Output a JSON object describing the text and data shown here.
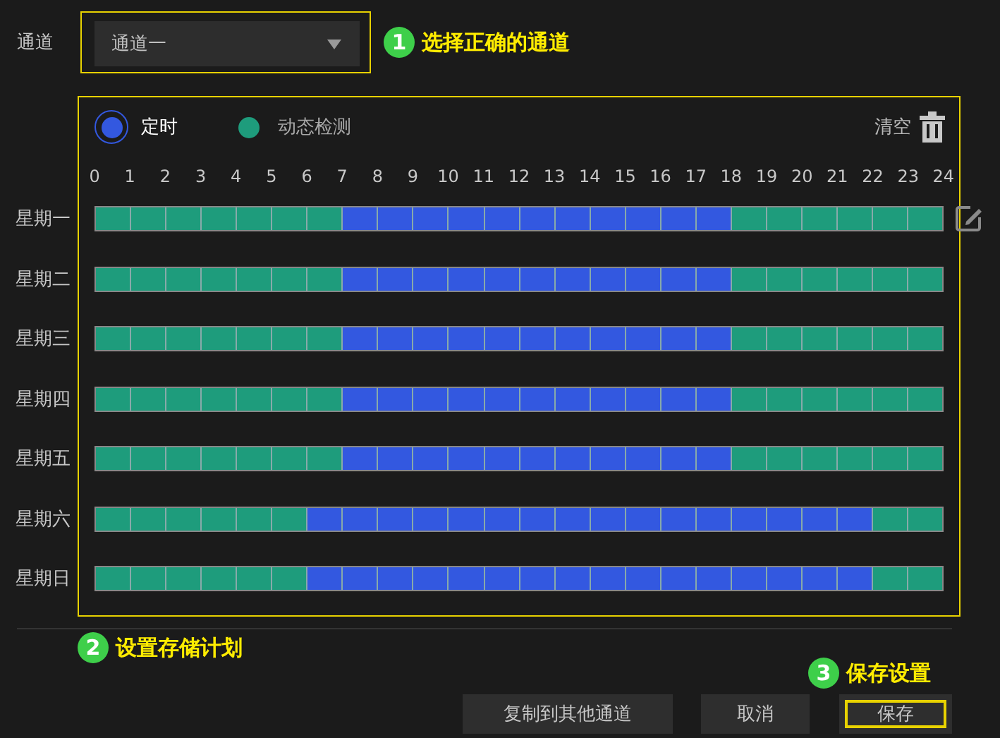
{
  "channel": {
    "label": "通道",
    "value": "通道一",
    "annotation": {
      "number": "1",
      "text": "选择正确的通道"
    }
  },
  "schedule": {
    "modes": [
      {
        "kind": "timed",
        "label": "定时",
        "selected": true,
        "color": "#3358e0"
      },
      {
        "kind": "motion",
        "label": "动态检测",
        "selected": false,
        "color": "#1e9c7c"
      }
    ],
    "clear_label": "清空",
    "hours": [
      "0",
      "1",
      "2",
      "3",
      "4",
      "5",
      "6",
      "7",
      "8",
      "9",
      "10",
      "11",
      "12",
      "13",
      "14",
      "15",
      "16",
      "17",
      "18",
      "19",
      "20",
      "21",
      "22",
      "23",
      "24"
    ],
    "days": [
      {
        "label": "星期一",
        "slots": [
          {
            "kind": "motion"
          },
          {
            "kind": "motion"
          },
          {
            "kind": "motion"
          },
          {
            "kind": "motion"
          },
          {
            "kind": "motion"
          },
          {
            "kind": "motion"
          },
          {
            "kind": "motion"
          },
          {
            "kind": "timed"
          },
          {
            "kind": "timed"
          },
          {
            "kind": "timed"
          },
          {
            "kind": "timed"
          },
          {
            "kind": "timed"
          },
          {
            "kind": "timed"
          },
          {
            "kind": "timed"
          },
          {
            "kind": "timed"
          },
          {
            "kind": "timed"
          },
          {
            "kind": "timed"
          },
          {
            "kind": "timed"
          },
          {
            "kind": "motion"
          },
          {
            "kind": "motion"
          },
          {
            "kind": "motion"
          },
          {
            "kind": "motion"
          },
          {
            "kind": "motion"
          },
          {
            "kind": "motion"
          }
        ]
      },
      {
        "label": "星期二",
        "slots": [
          {
            "kind": "motion"
          },
          {
            "kind": "motion"
          },
          {
            "kind": "motion"
          },
          {
            "kind": "motion"
          },
          {
            "kind": "motion"
          },
          {
            "kind": "motion"
          },
          {
            "kind": "motion"
          },
          {
            "kind": "timed"
          },
          {
            "kind": "timed"
          },
          {
            "kind": "timed"
          },
          {
            "kind": "timed"
          },
          {
            "kind": "timed"
          },
          {
            "kind": "timed"
          },
          {
            "kind": "timed"
          },
          {
            "kind": "timed"
          },
          {
            "kind": "timed"
          },
          {
            "kind": "timed"
          },
          {
            "kind": "timed"
          },
          {
            "kind": "motion"
          },
          {
            "kind": "motion"
          },
          {
            "kind": "motion"
          },
          {
            "kind": "motion"
          },
          {
            "kind": "motion"
          },
          {
            "kind": "motion"
          }
        ]
      },
      {
        "label": "星期三",
        "slots": [
          {
            "kind": "motion"
          },
          {
            "kind": "motion"
          },
          {
            "kind": "motion"
          },
          {
            "kind": "motion"
          },
          {
            "kind": "motion"
          },
          {
            "kind": "motion"
          },
          {
            "kind": "motion"
          },
          {
            "kind": "timed"
          },
          {
            "kind": "timed"
          },
          {
            "kind": "timed"
          },
          {
            "kind": "timed"
          },
          {
            "kind": "timed"
          },
          {
            "kind": "timed"
          },
          {
            "kind": "timed"
          },
          {
            "kind": "timed"
          },
          {
            "kind": "timed"
          },
          {
            "kind": "timed"
          },
          {
            "kind": "timed"
          },
          {
            "kind": "motion"
          },
          {
            "kind": "motion"
          },
          {
            "kind": "motion"
          },
          {
            "kind": "motion"
          },
          {
            "kind": "motion"
          },
          {
            "kind": "motion"
          }
        ]
      },
      {
        "label": "星期四",
        "slots": [
          {
            "kind": "motion"
          },
          {
            "kind": "motion"
          },
          {
            "kind": "motion"
          },
          {
            "kind": "motion"
          },
          {
            "kind": "motion"
          },
          {
            "kind": "motion"
          },
          {
            "kind": "motion"
          },
          {
            "kind": "timed"
          },
          {
            "kind": "timed"
          },
          {
            "kind": "timed"
          },
          {
            "kind": "timed"
          },
          {
            "kind": "timed"
          },
          {
            "kind": "timed"
          },
          {
            "kind": "timed"
          },
          {
            "kind": "timed"
          },
          {
            "kind": "timed"
          },
          {
            "kind": "timed"
          },
          {
            "kind": "timed"
          },
          {
            "kind": "motion"
          },
          {
            "kind": "motion"
          },
          {
            "kind": "motion"
          },
          {
            "kind": "motion"
          },
          {
            "kind": "motion"
          },
          {
            "kind": "motion"
          }
        ]
      },
      {
        "label": "星期五",
        "slots": [
          {
            "kind": "motion"
          },
          {
            "kind": "motion"
          },
          {
            "kind": "motion"
          },
          {
            "kind": "motion"
          },
          {
            "kind": "motion"
          },
          {
            "kind": "motion"
          },
          {
            "kind": "motion"
          },
          {
            "kind": "timed"
          },
          {
            "kind": "timed"
          },
          {
            "kind": "timed"
          },
          {
            "kind": "timed"
          },
          {
            "kind": "timed"
          },
          {
            "kind": "timed"
          },
          {
            "kind": "timed"
          },
          {
            "kind": "timed"
          },
          {
            "kind": "timed"
          },
          {
            "kind": "timed"
          },
          {
            "kind": "timed"
          },
          {
            "kind": "motion"
          },
          {
            "kind": "motion"
          },
          {
            "kind": "motion"
          },
          {
            "kind": "motion"
          },
          {
            "kind": "motion"
          },
          {
            "kind": "motion"
          }
        ]
      },
      {
        "label": "星期六",
        "slots": [
          {
            "kind": "motion"
          },
          {
            "kind": "motion"
          },
          {
            "kind": "motion"
          },
          {
            "kind": "motion"
          },
          {
            "kind": "motion"
          },
          {
            "kind": "motion"
          },
          {
            "kind": "timed"
          },
          {
            "kind": "timed"
          },
          {
            "kind": "timed"
          },
          {
            "kind": "timed"
          },
          {
            "kind": "timed"
          },
          {
            "kind": "timed"
          },
          {
            "kind": "timed"
          },
          {
            "kind": "timed"
          },
          {
            "kind": "timed"
          },
          {
            "kind": "timed"
          },
          {
            "kind": "timed"
          },
          {
            "kind": "timed"
          },
          {
            "kind": "timed"
          },
          {
            "kind": "timed"
          },
          {
            "kind": "timed"
          },
          {
            "kind": "timed"
          },
          {
            "kind": "motion"
          },
          {
            "kind": "motion"
          }
        ]
      },
      {
        "label": "星期日",
        "slots": [
          {
            "kind": "motion"
          },
          {
            "kind": "motion"
          },
          {
            "kind": "motion"
          },
          {
            "kind": "motion"
          },
          {
            "kind": "motion"
          },
          {
            "kind": "motion"
          },
          {
            "kind": "timed"
          },
          {
            "kind": "timed"
          },
          {
            "kind": "timed"
          },
          {
            "kind": "timed"
          },
          {
            "kind": "timed"
          },
          {
            "kind": "timed"
          },
          {
            "kind": "timed"
          },
          {
            "kind": "timed"
          },
          {
            "kind": "timed"
          },
          {
            "kind": "timed"
          },
          {
            "kind": "timed"
          },
          {
            "kind": "timed"
          },
          {
            "kind": "timed"
          },
          {
            "kind": "timed"
          },
          {
            "kind": "timed"
          },
          {
            "kind": "timed"
          },
          {
            "kind": "motion"
          },
          {
            "kind": "motion"
          }
        ]
      }
    ],
    "annotation": {
      "number": "2",
      "text": "设置存储计划"
    }
  },
  "actions": {
    "annotation": {
      "number": "3",
      "text": "保存设置"
    },
    "buttons": [
      {
        "label": "复制到其他通道",
        "highlighted": false
      },
      {
        "label": "取消",
        "highlighted": false
      },
      {
        "label": "保存",
        "highlighted": true
      }
    ]
  }
}
